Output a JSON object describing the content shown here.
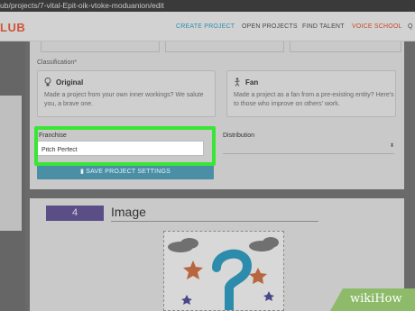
{
  "url": "ub/projects/7-vital-Epit-oik-vtoke-moduanion/edit",
  "logo": "LUB",
  "nav": {
    "create": "CREATE PROJECT",
    "open": "OPEN PROJECTS",
    "talent": "FIND TALENT",
    "school": "VOICE SCHOOL",
    "more": "Q"
  },
  "classification": {
    "label": "Classification",
    "original": {
      "title": "Original",
      "desc": "Made a project from your own inner workings? We salute you, a brave one."
    },
    "fan": {
      "title": "Fan",
      "desc": "Made a project as a fan from a pre-existing entity? Here's to those who improve on others' work."
    }
  },
  "franchise": {
    "label": "Franchise",
    "value": "Pitch Perfect"
  },
  "distribution": {
    "label": "Distribution"
  },
  "save_label": "SAVE PROJECT SETTINGS",
  "image_section": {
    "step": "4",
    "title": "Image"
  },
  "watermark": "wikiHow",
  "colors": {
    "highlight": "#39e635",
    "accent": "#4a8fa6",
    "purple": "#5b4d86"
  }
}
